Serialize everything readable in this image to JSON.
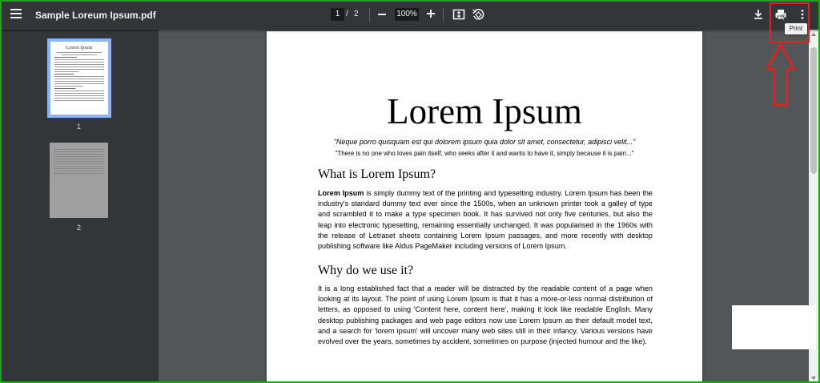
{
  "toolbar": {
    "menu_icon": "hamburger-menu-icon",
    "title": "Sample Loreum Ipsum.pdf",
    "current_page": "1",
    "page_separator": "/",
    "total_pages": "2",
    "zoom": "100%",
    "tooltip": "Print"
  },
  "thumbnails": {
    "page1_title": "Lorem Ipsum",
    "page1_number": "1",
    "page2_number": "2"
  },
  "document": {
    "title": "Lorem Ipsum",
    "quote": "\"Neque porro quisquam est qui dolorem ipsum quia dolor sit amet, consectetur, adipisci velit...\"",
    "quote_translation": "\"There is no one who loves pain itself, who seeks after it and wants to have it, simply because it is pain...\"",
    "heading1": "What is Lorem Ipsum?",
    "para1_bold": "Lorem Ipsum",
    "para1_text": " is simply dummy text of the printing and typesetting industry. Lorem Ipsum has been the industry's standard dummy text ever since the 1500s, when an unknown printer took a galley of type and scrambled it to make a type specimen book. It has survived not only five centuries, but also the leap into electronic typesetting, remaining essentially unchanged. It was popularised in the 1960s with the release of Letraset sheets containing Lorem Ipsum passages, and more recently with desktop publishing software like Aldus PageMaker including versions of Lorem Ipsum.",
    "heading2": "Why do we use it?",
    "para2": "It is a long established fact that a reader will be distracted by the readable content of a page when looking at its layout. The point of using Lorem Ipsum is that it has a more-or-less normal distribution of letters, as opposed to using 'Content here, content here', making it look like readable English. Many desktop publishing packages and web page editors now use Lorem Ipsum as their default model text, and a search for 'lorem ipsum' will uncover many web sites still in their infancy. Various versions have evolved over the years, sometimes by accident, sometimes on purpose (injected humour and the like)."
  },
  "colors": {
    "toolbar_bg": "#323639",
    "viewer_bg": "#525659",
    "thumb_selected": "#8ab4f8",
    "annotation_red": "#e8201a",
    "frame_green": "#18a818"
  }
}
